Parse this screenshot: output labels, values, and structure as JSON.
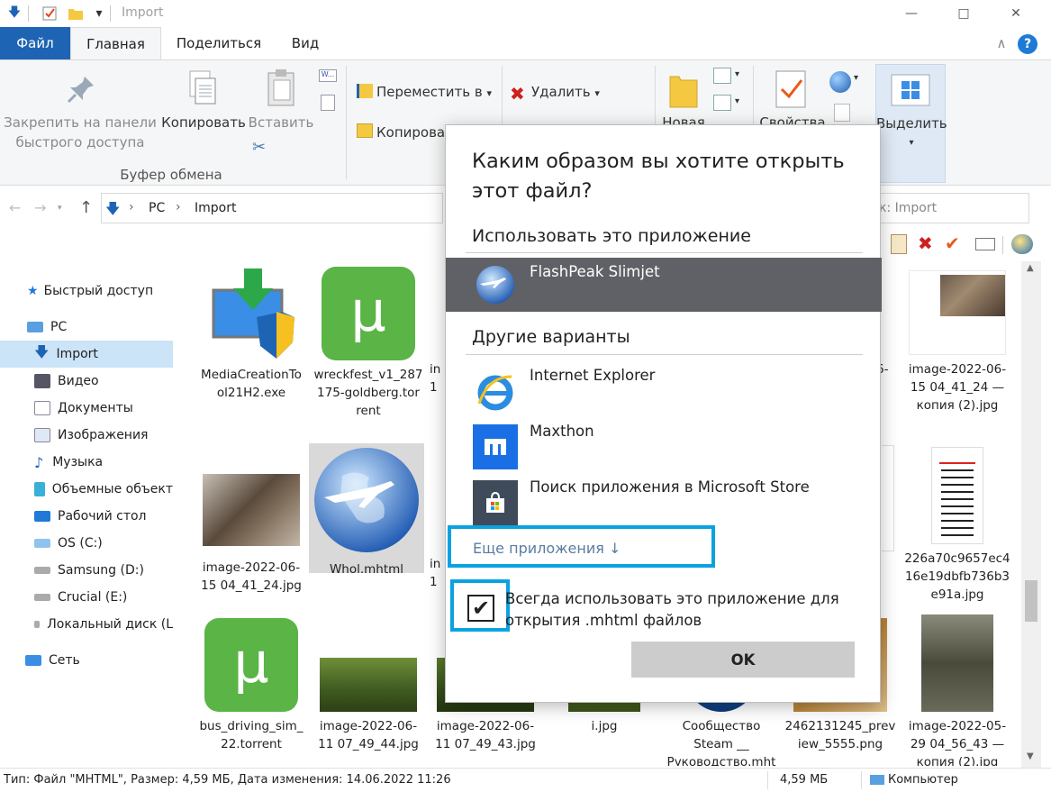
{
  "window": {
    "title": "Import"
  },
  "titlebar": {
    "qat_dropdown": "▾",
    "minimize": "—",
    "maximize": "□",
    "close": "✕"
  },
  "menu": {
    "tabs": [
      "Файл",
      "Главная",
      "Поделиться",
      "Вид"
    ],
    "collapse": "∧",
    "help": "?"
  },
  "ribbon": {
    "pin_line1": "Закрепить на панели",
    "pin_line2": "быстрого доступа",
    "copy": "Копировать",
    "paste": "Вставить",
    "clipboard_group": "Буфер обмена",
    "move_to": "Переместить в",
    "copy_to": "Копирова",
    "delete": "Удалить",
    "new_folder": "Новая",
    "properties": "Свойства",
    "select": "Выделить",
    "dropdown": "▾"
  },
  "address": {
    "back": "←",
    "forward": "→",
    "up": "↑",
    "crumbs": [
      "PC",
      "Import"
    ],
    "sep": "›",
    "search_placeholder": "к: Import"
  },
  "nav": [
    "Быстрый доступ",
    "PC",
    "Import",
    "Видео",
    "Документы",
    "Изображения",
    "Музыка",
    "Объемные объект",
    "Рабочий стол",
    "OS (C:)",
    "Samsung (D:)",
    "Crucial (E:)",
    "Локальный диск (L",
    "Сеть"
  ],
  "files": [
    {
      "l1": "MediaCreationTo",
      "l2": "ol21H2.exe",
      "l3": ""
    },
    {
      "l1": "wreckfest_v1_287",
      "l2": "175-goldberg.tor",
      "l3": "rent"
    },
    {
      "l1": "image-2022-06-",
      "l2": "15 04_41_24 —",
      "l3": "копия (2).jpg"
    },
    {
      "l1": "image-2022-06-",
      "l2": "15 04_41_24.jpg",
      "l3": ""
    },
    {
      "l1": "Whol.mhtml",
      "l2": "",
      "l3": ""
    },
    {
      "l1": "226a70c9657ec4",
      "l2": "16e19dbfb736b3",
      "l3": "e91a.jpg"
    },
    {
      "l1": "bus_driving_sim_",
      "l2": "22.torrent",
      "l3": ""
    },
    {
      "l1": "image-2022-06-",
      "l2": "11 07_49_44.jpg",
      "l3": ""
    },
    {
      "l1": "image-2022-06-",
      "l2": "11 07_49_43.jpg",
      "l3": ""
    },
    {
      "l1": "i.jpg",
      "l2": "",
      "l3": ""
    },
    {
      "l1": "Сообщество",
      "l2": "Steam __",
      "l3": "Руководство.mht"
    },
    {
      "l1": "2462131245_prev",
      "l2": "iew_5555.png",
      "l3": ""
    },
    {
      "l1": "image-2022-05-",
      "l2": "29 04_56_43 —",
      "l3": "копия (2).jpg"
    },
    {
      "l1": "in",
      "l2": "1",
      "l3": ""
    },
    {
      "l1": "in",
      "l2": "1",
      "l3": ""
    },
    {
      "l1": "6-",
      "l2": "",
      "l3": ""
    }
  ],
  "status": {
    "text": "Тип: Файл \"MHTML\", Размер: 4,59 МБ, Дата изменения: 14.06.2022 11:26",
    "size": "4,59 МБ",
    "location": "Компьютер"
  },
  "dialog": {
    "title": "Каким образом вы хотите открыть этот файл?",
    "use_this_app": "Использовать это приложение",
    "selected_app": "FlashPeak Slimjet",
    "other_options": "Другие варианты",
    "apps": [
      "Internet Explorer",
      "Maxthon",
      "Поиск приложения в Microsoft Store"
    ],
    "more_apps": "Еще приложения ↓",
    "always_use": "Всегда использовать это приложение для открытия .mhtml файлов",
    "checkmark": "✔",
    "ok": "OK"
  },
  "colors": {
    "accent": "#1e64b4",
    "highlight": "#0aa2e0",
    "selected_app_bg": "#5f6166",
    "utorrent": "#5ab446",
    "nav_selected": "#cce4f7"
  }
}
